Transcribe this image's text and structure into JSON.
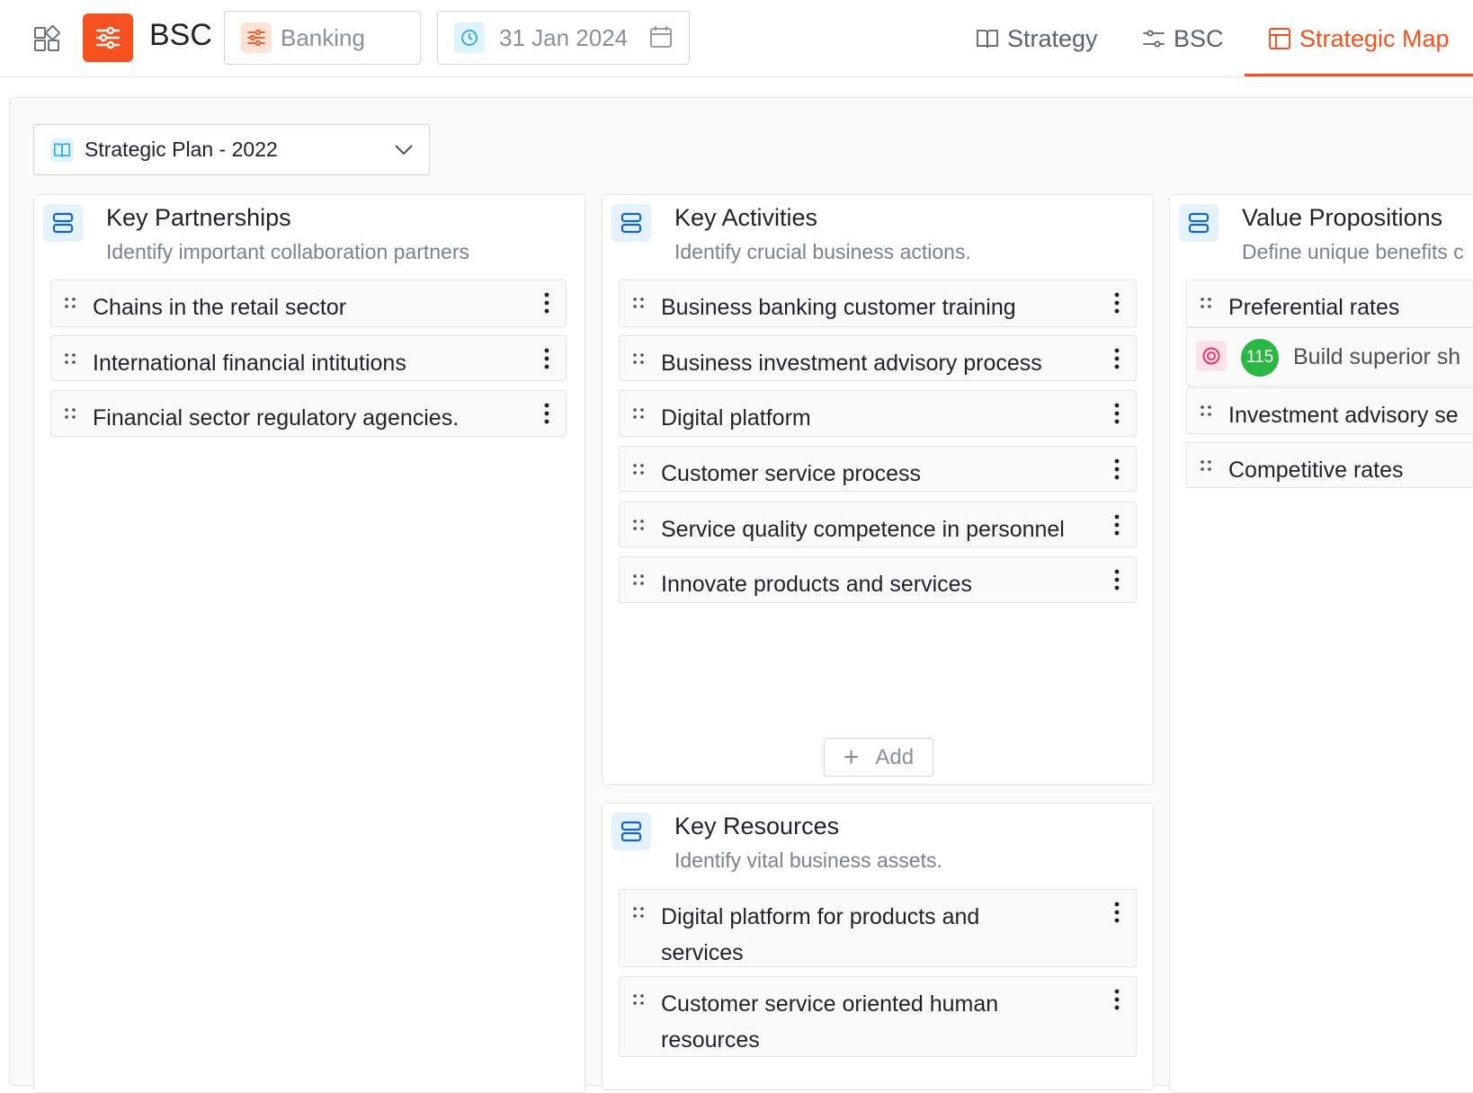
{
  "app": {
    "name": "BSC"
  },
  "org_select": {
    "label": "Banking"
  },
  "date_select": {
    "label": "31 Jan 2024"
  },
  "tabs": [
    {
      "label": "Strategy",
      "active": false
    },
    {
      "label": "BSC",
      "active": false
    },
    {
      "label": "Strategic Map",
      "active": true
    }
  ],
  "plan_select": {
    "label": "Strategic Plan - 2022"
  },
  "columns": {
    "key_partnerships": {
      "title": "Key Partnerships",
      "subtitle": "Identify important collaboration partners",
      "items": [
        "Chains in the retail sector",
        "International financial intitutions",
        "Financial sector regulatory agencies."
      ]
    },
    "key_activities": {
      "title": "Key Activities",
      "subtitle": "Identify crucial business actions.",
      "items": [
        "Business banking customer training",
        "Business investment advisory process",
        "Digital platform",
        "Customer service process",
        "Service quality competence in personnel",
        "Innovate products and services"
      ],
      "add_label": "Add"
    },
    "key_resources": {
      "title": "Key Resources",
      "subtitle": "Identify vital business assets.",
      "items": [
        [
          "Digital platform for products and",
          "services"
        ],
        [
          "Customer service oriented human",
          "resources"
        ]
      ]
    },
    "value_propositions": {
      "title": "Value Propositions",
      "subtitle": "Define unique benefits c",
      "items": [
        "Preferential rates",
        "Build superior sh",
        "Investment advisory se",
        "Competitive rates"
      ],
      "objective_badge": "115"
    }
  },
  "colors": {
    "accent": "#f4511e",
    "badge_green": "#2bb744",
    "icon_blue": "#1565c0"
  }
}
